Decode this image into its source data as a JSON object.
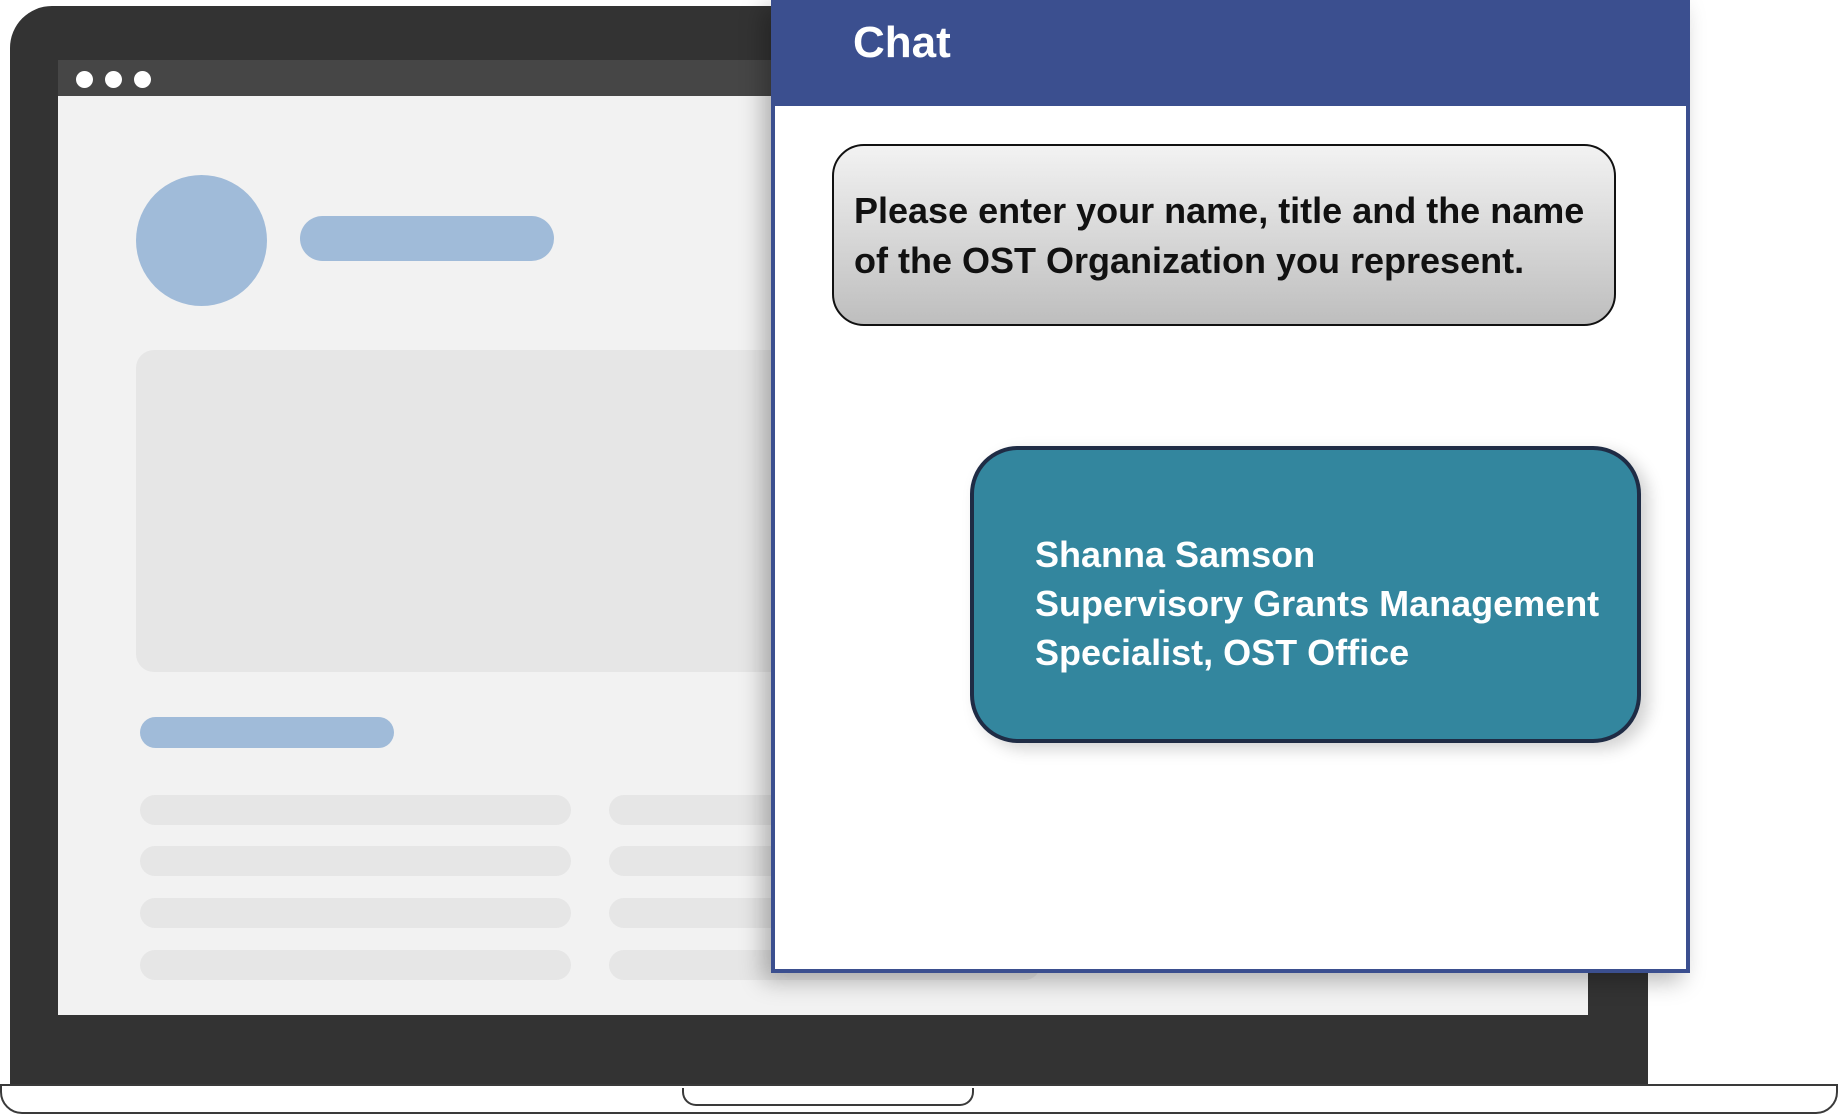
{
  "chat": {
    "title": "Chat",
    "messages": [
      {
        "role": "bot",
        "text": "Please enter your name, title and the name\nof the  OST Organization you represent."
      },
      {
        "role": "user",
        "text": "Shanna Samson\nSupervisory Grants Management\nSpecialist, OST Office"
      }
    ]
  },
  "colors": {
    "chat_header": "#3b4f8f",
    "user_bubble": "#33869e",
    "placeholder_accent": "#a0bbd9",
    "laptop_body": "#333333"
  }
}
